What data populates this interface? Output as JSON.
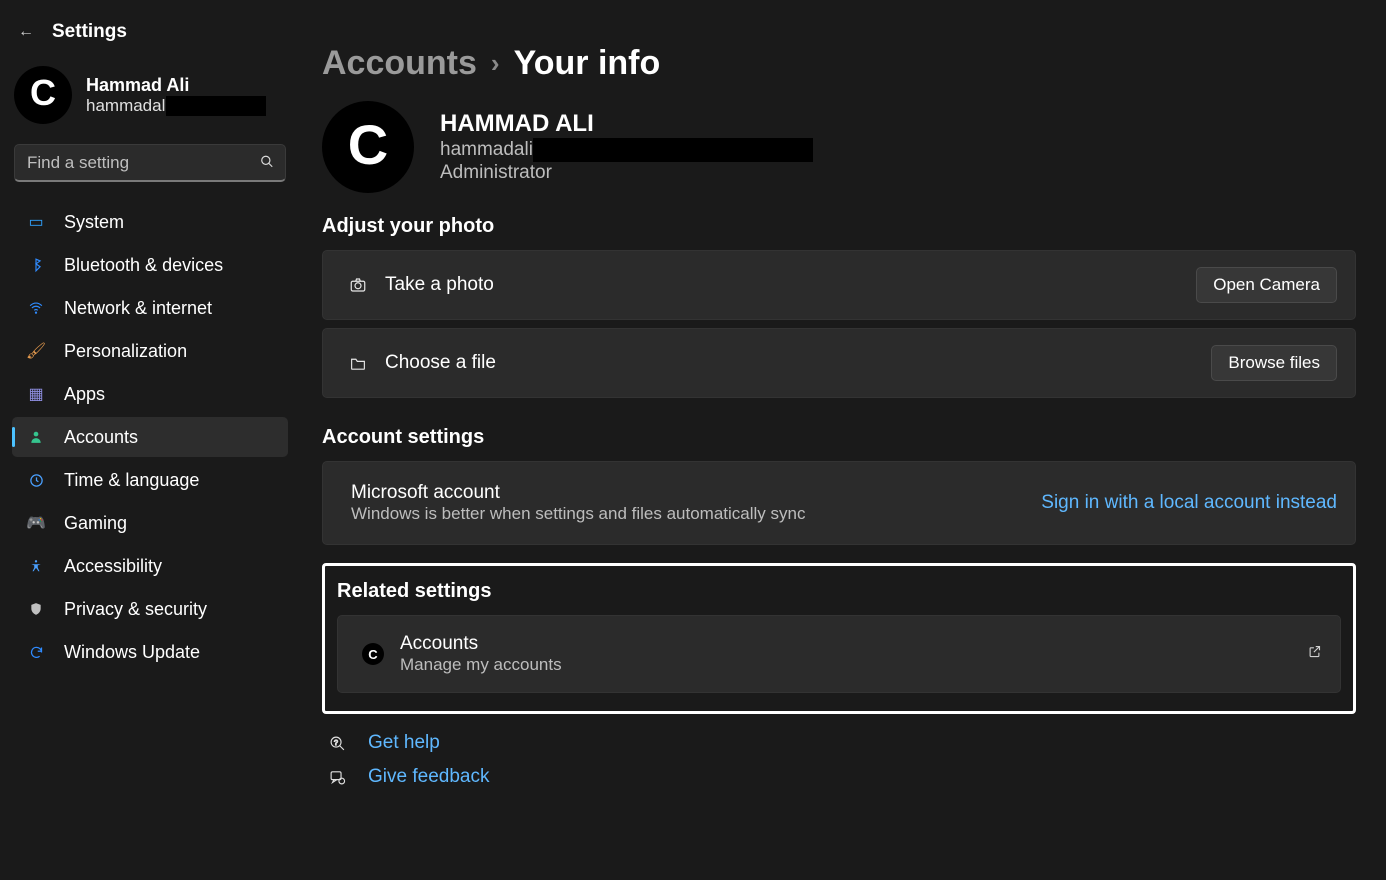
{
  "app": {
    "title": "Settings"
  },
  "user": {
    "name": "Hammad Ali",
    "email_prefix": "hammadal",
    "avatar_letter": "C"
  },
  "search": {
    "placeholder": "Find a setting"
  },
  "nav": {
    "items": [
      {
        "label": "System"
      },
      {
        "label": "Bluetooth & devices"
      },
      {
        "label": "Network & internet"
      },
      {
        "label": "Personalization"
      },
      {
        "label": "Apps"
      },
      {
        "label": "Accounts"
      },
      {
        "label": "Time & language"
      },
      {
        "label": "Gaming"
      },
      {
        "label": "Accessibility"
      },
      {
        "label": "Privacy & security"
      },
      {
        "label": "Windows Update"
      }
    ]
  },
  "breadcrumb": {
    "parent": "Accounts",
    "separator": "›",
    "current": "Your info"
  },
  "profile": {
    "name": "HAMMAD ALI",
    "email_prefix": "hammadali",
    "role": "Administrator",
    "avatar_letter": "C"
  },
  "sections": {
    "photo_title": "Adjust your photo",
    "take_photo_label": "Take a photo",
    "open_camera_btn": "Open Camera",
    "choose_file_label": "Choose a file",
    "browse_btn": "Browse files",
    "account_settings_title": "Account settings",
    "ms_account_title": "Microsoft account",
    "ms_account_sub": "Windows is better when settings and files automatically sync",
    "local_account_link": "Sign in with a local account instead",
    "related_title": "Related settings",
    "related_accounts_title": "Accounts",
    "related_accounts_sub": "Manage my accounts"
  },
  "footer": {
    "get_help": "Get help",
    "give_feedback": "Give feedback"
  }
}
